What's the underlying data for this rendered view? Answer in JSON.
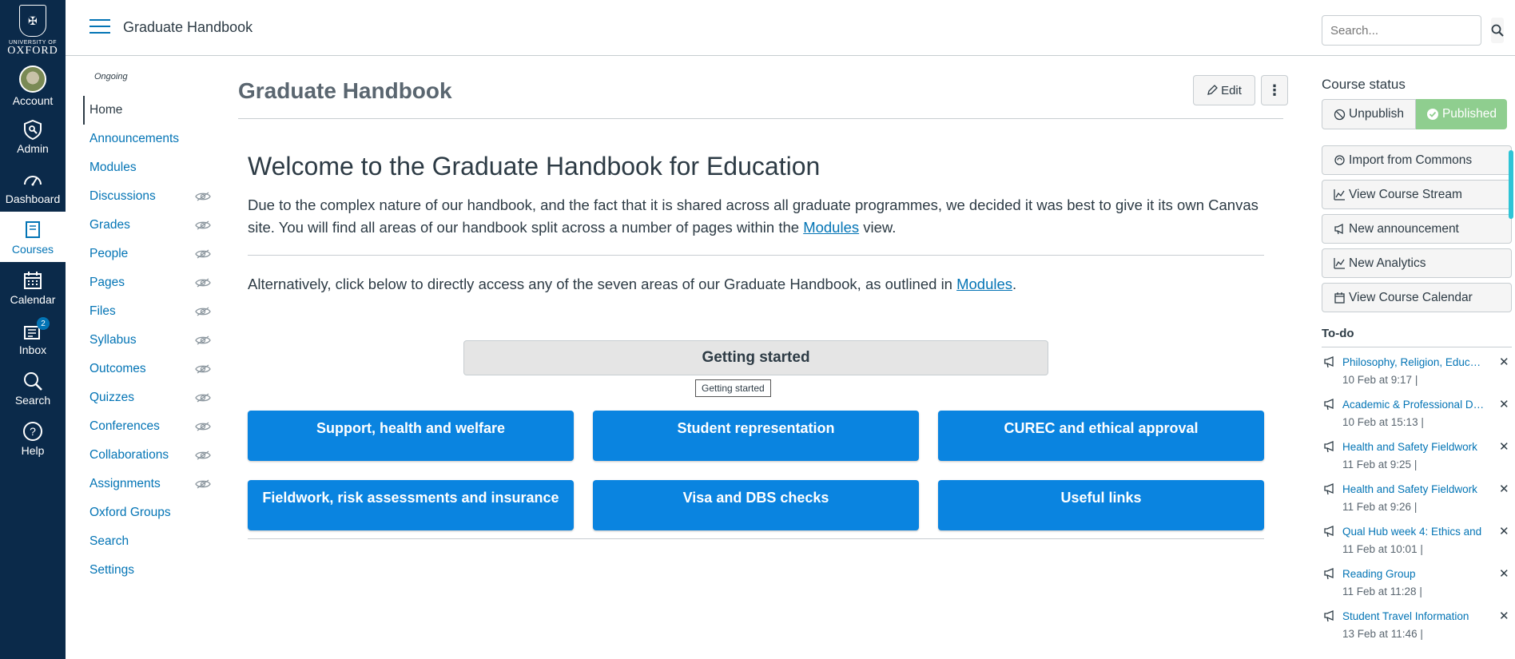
{
  "logo": {
    "crest_glyph": "✠",
    "university": "UNIVERSITY OF",
    "name": "OXFORD"
  },
  "global_nav": [
    {
      "label": "Account",
      "icon": "avatar"
    },
    {
      "label": "Admin",
      "icon": "shield-icon"
    },
    {
      "label": "Dashboard",
      "icon": "dashboard-icon"
    },
    {
      "label": "Courses",
      "icon": "book-icon",
      "active": true
    },
    {
      "label": "Calendar",
      "icon": "calendar-icon"
    },
    {
      "label": "Inbox",
      "icon": "inbox-icon",
      "badge": "2"
    },
    {
      "label": "Search",
      "icon": "search-icon"
    },
    {
      "label": "Help",
      "icon": "help-icon"
    }
  ],
  "header": {
    "breadcrumb": "Graduate Handbook",
    "search_placeholder": "Search..."
  },
  "course_nav": {
    "term": "Ongoing",
    "items": [
      {
        "label": "Home",
        "active": true,
        "hidden": false
      },
      {
        "label": "Announcements",
        "hidden": false
      },
      {
        "label": "Modules",
        "hidden": false
      },
      {
        "label": "Discussions",
        "hidden": true
      },
      {
        "label": "Grades",
        "hidden": true
      },
      {
        "label": "People",
        "hidden": true
      },
      {
        "label": "Pages",
        "hidden": true
      },
      {
        "label": "Files",
        "hidden": true
      },
      {
        "label": "Syllabus",
        "hidden": true
      },
      {
        "label": "Outcomes",
        "hidden": true
      },
      {
        "label": "Quizzes",
        "hidden": true
      },
      {
        "label": "Conferences",
        "hidden": true
      },
      {
        "label": "Collaborations",
        "hidden": true
      },
      {
        "label": "Assignments",
        "hidden": true
      },
      {
        "label": "Oxford Groups",
        "hidden": false
      },
      {
        "label": "Search",
        "hidden": false
      },
      {
        "label": "Settings",
        "hidden": false
      }
    ]
  },
  "page": {
    "title": "Graduate Handbook",
    "edit_label": "Edit",
    "more_label": "⋮",
    "welcome": "Welcome to the Graduate Handbook for Education",
    "para1_a": "Due to the complex nature of our handbook, and the fact that it is shared across all graduate programmes, we decided it was best to give it its own Canvas site. You will find all areas of our handbook split across a number of pages within the ",
    "para1_link": "Modules",
    "para1_b": " view.",
    "para2_a": "Alternatively, click below to directly access any of the seven areas of our Graduate Handbook, as outlined in ",
    "para2_link": "Modules",
    "para2_b": ".",
    "getting_started": "Getting started",
    "tooltip": "Getting started",
    "buttons": [
      "Support, health and welfare",
      "Student representation",
      "CUREC and ethical approval",
      "Fieldwork, risk assessments and insurance",
      "Visa and DBS checks",
      "Useful links"
    ]
  },
  "sidebar": {
    "course_status": "Course status",
    "unpublish": "Unpublish",
    "published": "Published",
    "actions": [
      {
        "label": "Import from Commons",
        "icon": "commons-icon"
      },
      {
        "label": "View Course Stream",
        "icon": "stream-icon"
      },
      {
        "label": "New announcement",
        "icon": "announcement-icon"
      },
      {
        "label": "New Analytics",
        "icon": "analytics-icon"
      },
      {
        "label": "View Course Calendar",
        "icon": "calendar-icon"
      }
    ],
    "todo_title": "To-do",
    "todos": [
      {
        "title": "Philosophy, Religion, Education",
        "date": "10 Feb at 9:17 |"
      },
      {
        "title": "Academic & Professional Development",
        "date": "10 Feb at 15:13 |"
      },
      {
        "title": "Health and Safety Fieldwork",
        "date": "11 Feb at 9:25 |"
      },
      {
        "title": "Health and Safety Fieldwork",
        "date": "11 Feb at 9:26 |"
      },
      {
        "title": "Qual Hub week 4: Ethics and",
        "date": "11 Feb at 10:01 |"
      },
      {
        "title": "Reading Group",
        "date": "11 Feb at 11:28 |"
      },
      {
        "title": "Student Travel Information",
        "date": "13 Feb at 11:46 |"
      }
    ]
  },
  "colors": {
    "nav_bg": "#0b2a4a",
    "link": "#0374b5",
    "button_blue": "#0a84e0",
    "published_green": "#8fce8f"
  }
}
